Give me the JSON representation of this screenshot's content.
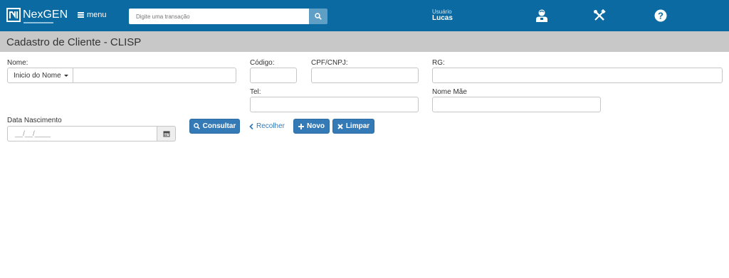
{
  "header": {
    "brand": "NexGEN",
    "menu_label": "menu",
    "search_placeholder": "Digite uma transação",
    "user_label": "Usuário",
    "user_name": "Lucas"
  },
  "page": {
    "title": "Cadastro de Cliente - CLISP"
  },
  "form": {
    "nome_label": "Nome:",
    "nome_filter_option": "Inicio do Nome",
    "codigo_label": "Código:",
    "cpf_label": "CPF/CNPJ:",
    "rg_label": "RG:",
    "tel_label": "Tel:",
    "nome_mae_label": "Nome Mãe",
    "data_nasc_label": "Data Nascimento",
    "data_nasc_value": "__/__/____"
  },
  "buttons": {
    "consultar": "Consultar",
    "recolher": "Recolher",
    "novo": "Novo",
    "limpar": "Limpar"
  },
  "colors": {
    "header_bg": "#0a6aa1",
    "title_bg": "#c8c8c8",
    "primary": "#337ab7"
  },
  "icons": [
    "logo-icon",
    "menu-icon",
    "search-icon",
    "user-icon",
    "tools-icon",
    "help-icon",
    "calendar-icon",
    "chevron-left-icon",
    "plus-icon",
    "x-icon"
  ]
}
